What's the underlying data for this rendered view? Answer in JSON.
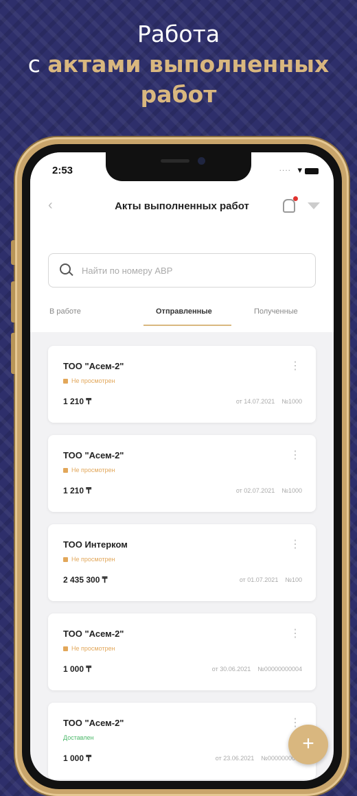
{
  "headline": {
    "line1": "Работа",
    "line2_prefix": "с ",
    "line2_accent": "актами выполненных",
    "line3_accent": "работ"
  },
  "status_bar": {
    "time": "2:53",
    "dots": "....",
    "wifi": "▾"
  },
  "appbar": {
    "back": "‹",
    "title": "Акты выполненных работ"
  },
  "search": {
    "placeholder": "Найти по номеру АВР"
  },
  "tabs": [
    {
      "label": "В работе",
      "active": false
    },
    {
      "label": "Отправленные",
      "active": true
    },
    {
      "label": "Полученные",
      "active": false
    }
  ],
  "cards": [
    {
      "company": "ТОО \"Асем-2\"",
      "status": "Не просмотрен",
      "amount": "1 210 ₸",
      "date": "от 14.07.2021",
      "number": "№1000"
    },
    {
      "company": "ТОО \"Асем-2\"",
      "status": "Не просмотрен",
      "amount": "1 210 ₸",
      "date": "от 02.07.2021",
      "number": "№1000"
    },
    {
      "company": "ТОО Интерком",
      "status": "Не просмотрен",
      "amount": "2 435 300 ₸",
      "date": "от 01.07.2021",
      "number": "№100"
    },
    {
      "company": "ТОО \"Асем-2\"",
      "status": "Не просмотрен",
      "amount": "1 000 ₸",
      "date": "от 30.06.2021",
      "number": "№00000000004"
    },
    {
      "company": "ТОО \"Асем-2\"",
      "status": "Доставлен",
      "amount": "1 000 ₸",
      "date": "от 23.06.2021",
      "number": "№0000000000"
    }
  ],
  "kebab": "⋮",
  "fab": {
    "label": "+"
  },
  "colors": {
    "background": "#2e2f6b",
    "accent": "#d9b77f",
    "pending": "#e2a75a",
    "delivered": "#4cb96a",
    "frame": "#c9a56b"
  }
}
